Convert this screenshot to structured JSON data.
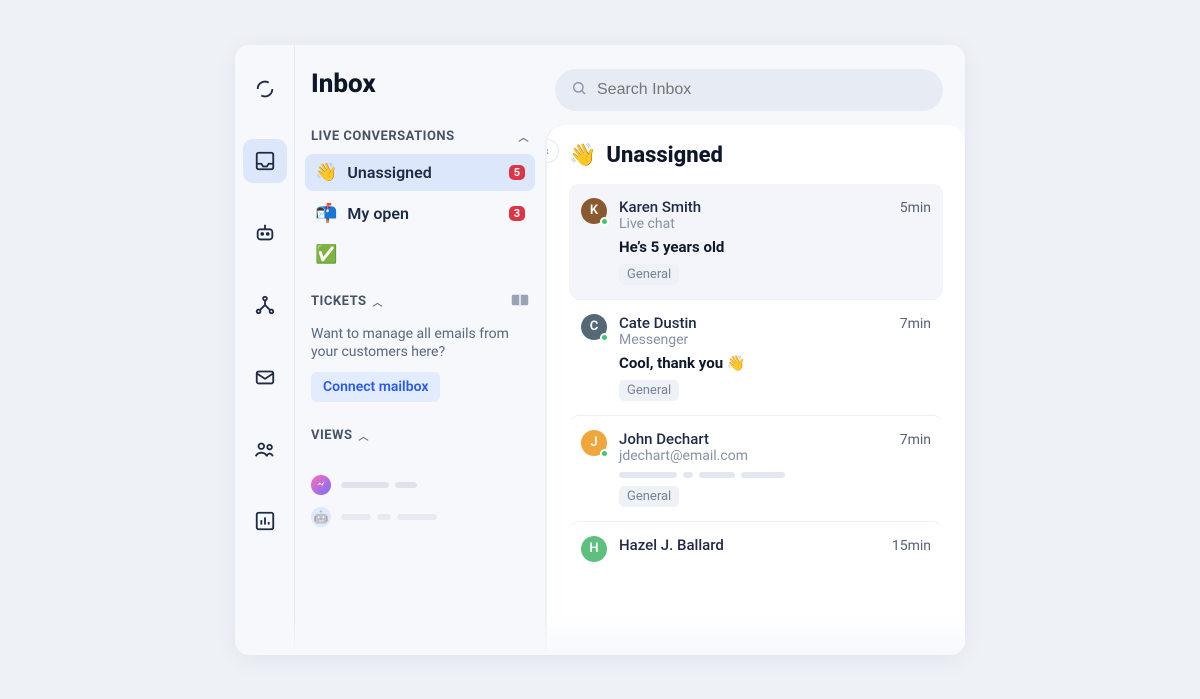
{
  "rail": {
    "items": [
      {
        "name": "logo",
        "active": false
      },
      {
        "name": "inbox",
        "active": true
      },
      {
        "name": "bot",
        "active": false
      },
      {
        "name": "flows",
        "active": false
      },
      {
        "name": "mail",
        "active": false
      },
      {
        "name": "contacts",
        "active": false
      },
      {
        "name": "reports",
        "active": false
      }
    ]
  },
  "inbox": {
    "title": "Inbox",
    "sections": {
      "live": {
        "header": "LIVE CONVERSATIONS",
        "items": [
          {
            "emoji": "👋",
            "label": "Unassigned",
            "badge": "5",
            "active": true
          },
          {
            "emoji": "📬",
            "label": "My open",
            "badge": "3",
            "active": false
          },
          {
            "emoji": "✅",
            "label": "",
            "badge": "",
            "active": false
          }
        ]
      },
      "tickets": {
        "header": "TICKETS",
        "message": "Want to manage all emails from your customers here?",
        "cta": "Connect mailbox"
      },
      "views": {
        "header": "VIEWS"
      }
    }
  },
  "search": {
    "placeholder": "Search Inbox"
  },
  "list": {
    "title_emoji": "👋",
    "title": "Unassigned",
    "items": [
      {
        "initial": "K",
        "avatar_color": "#8a5a2e",
        "name": "Karen Smith",
        "time": "5min",
        "source": "Live chat",
        "preview": "He’s 5 years old",
        "tag": "General",
        "active": true,
        "redacted": false
      },
      {
        "initial": "C",
        "avatar_color": "#556876",
        "name": "Cate Dustin",
        "time": "7min",
        "source": "Messenger",
        "preview": "Cool, thank you 👋",
        "tag": "General",
        "active": false,
        "redacted": false
      },
      {
        "initial": "J",
        "avatar_color": "#f0a63a",
        "name": "John Dechart",
        "time": "7min",
        "source": "jdechart@email.com",
        "preview": "",
        "tag": "General",
        "active": false,
        "redacted": true
      },
      {
        "initial": "H",
        "avatar_color": "#5fbf7f",
        "name": "Hazel J. Ballard",
        "time": "15min",
        "source": "",
        "preview": "",
        "tag": "",
        "active": false,
        "redacted": false
      }
    ]
  }
}
